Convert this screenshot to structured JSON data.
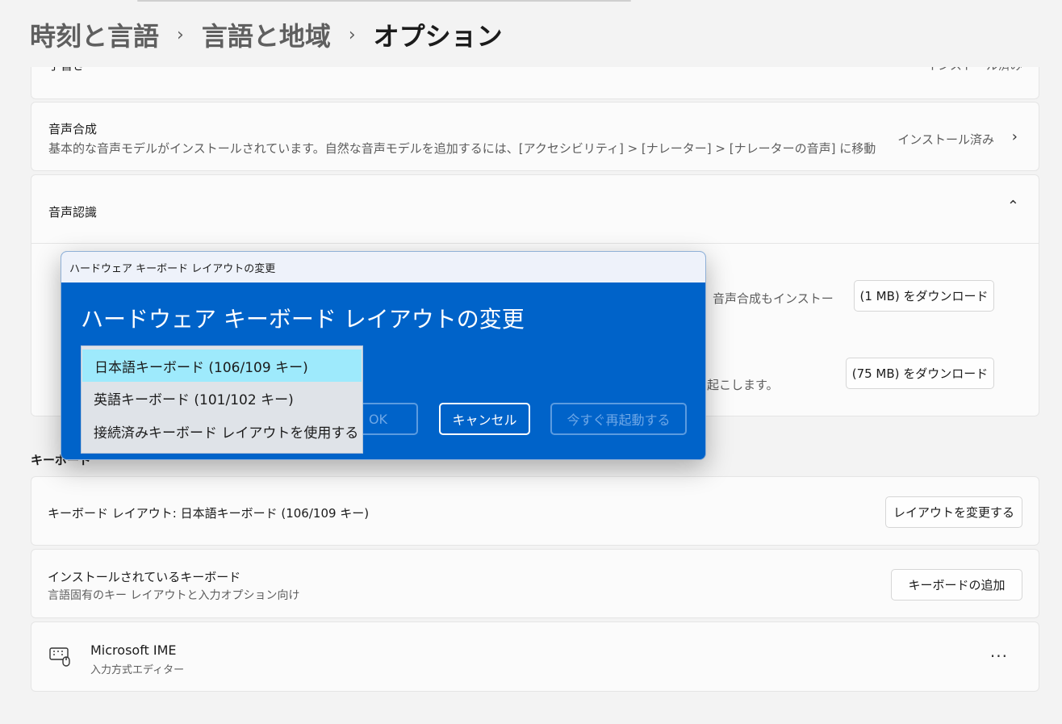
{
  "breadcrumb": {
    "item1": "時刻と言語",
    "item2": "言語と地域",
    "current": "オプション",
    "separator": "›"
  },
  "partial_row": {
    "title": "手書き",
    "status": "インストール済み"
  },
  "speech_synthesis": {
    "title": "音声合成",
    "description": "基本的な音声モデルがインストールされています。自然な音声モデルを追加するには、[アクセシビリティ] > [ナレーター] > [ナレーターの音声] に移動",
    "status": "インストール済み"
  },
  "speech_recognition": {
    "title": "音声認識",
    "row1_text": "音声合成もインストー",
    "row1_button": "(1 MB) をダウンロード",
    "row2_text": "起こします。",
    "row2_button": "(75 MB) をダウンロード"
  },
  "keyboard_section": {
    "label": "キーボード",
    "layout_text": "キーボード レイアウト: 日本語キーボード (106/109 キー)",
    "layout_button": "レイアウトを変更する",
    "installed_title": "インストールされているキーボード",
    "installed_sub": "言語固有のキー レイアウトと入力オプション向け",
    "installed_button": "キーボードの追加",
    "ime_name": "Microsoft IME",
    "ime_sub": "入力方式エディター",
    "more_label": "···"
  },
  "dialog": {
    "titlebar": "ハードウェア キーボード レイアウトの変更",
    "heading": "ハードウェア キーボード レイアウトの変更",
    "ok": "OK",
    "cancel": "キャンセル",
    "restart": "今すぐ再起動する",
    "options": [
      "日本語キーボード (106/109 キー)",
      "英語キーボード (101/102 キー)",
      "接続済みキーボード レイアウトを使用する"
    ],
    "selected_option": "日本語キーボード (106/109 キー)"
  },
  "colors": {
    "dialog_blue": "#0063c9",
    "dropdown_highlight": "#9eeafc",
    "page_bg": "#f3f3f3"
  },
  "icons": {
    "chevron_right": "chevron-right-icon",
    "chevron_up": "chevron-up-icon",
    "keyboard": "keyboard-icon",
    "more": "more-icon"
  }
}
